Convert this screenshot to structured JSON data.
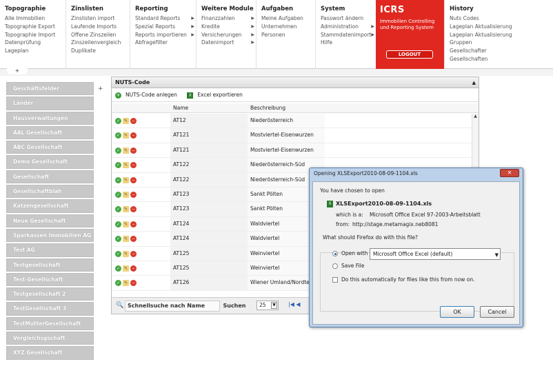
{
  "menu": {
    "topographie": {
      "title": "Topographie",
      "items": [
        "Alle Immobilien",
        "Topographie Export",
        "Topographie Import",
        "Datenprüfung",
        "Lageplan"
      ]
    },
    "zinslisten": {
      "title": "Zinslisten",
      "items": [
        "Zinslisten import",
        "Laufende Imports",
        "Offene Zinszeilen",
        "Zinszeilenvergleich",
        "Duplikate"
      ]
    },
    "reporting": {
      "title": "Reporting",
      "items": [
        "Standard Reports",
        "Spezial Reports",
        "Reports importieren",
        "Abfragefilter"
      ]
    },
    "weitere": {
      "title": "Weitere Module",
      "items": [
        "Finanzzahlen",
        "Kredite",
        "Versicherungen",
        "Datenimport"
      ]
    },
    "aufgaben": {
      "title": "Aufgaben",
      "items": [
        "Meine Aufgaben",
        "Unternehmen",
        "Personen"
      ]
    },
    "system": {
      "title": "System",
      "items": [
        "Passwort ändern",
        "Administration",
        "Stammdatenimport",
        "Hilfe"
      ]
    },
    "history": {
      "title": "History",
      "items": [
        "Nuts Codes",
        "Lageplan Aktualisierung",
        "Lageplan Aktualisierung",
        "Gruppen",
        "Gesellschafter",
        "Gesellschaften"
      ]
    }
  },
  "icrs": {
    "title": "ICRS",
    "subtitle": "Immobilien Controlling und Reporting System",
    "logout": "LOGOUT"
  },
  "plus_tab": "+",
  "sidebar": {
    "plus": "+",
    "items": [
      "Geschäftsfelder",
      "Länder",
      "Hausverwaltungen",
      "AAL Gesellschaft",
      "ABC Gesellschaft",
      "Demo Gesellschaft",
      "Gesellschaft",
      "Gesellschaftblah",
      "Katzengesellschaft",
      "Neue Gesellschaft",
      "Sparkassen Immobilien AG",
      "Test AG",
      "Testgesellschaft",
      "Test-Gesellschaft",
      "Testgesellschaft 2",
      "TestGesellschaft 3",
      "TestMutterGesellschaft",
      "Vergleichsgschaft",
      "XYZ Gesellschaft"
    ]
  },
  "panel": {
    "title": "NUTS-Code",
    "collapse": "▲",
    "add_label": "NUTS-Code anlegen",
    "export_label": "Excel exportieren",
    "columns": {
      "name": "Name",
      "beschreibung": "Beschreibung"
    },
    "rows": [
      {
        "name": "AT12",
        "desc": "Niederösterreich"
      },
      {
        "name": "AT121",
        "desc": "Mostviertel-Eisenwurzen"
      },
      {
        "name": "AT121",
        "desc": "Mostviertel-Eisenwurzen"
      },
      {
        "name": "AT122",
        "desc": "Niederösterreich-Süd"
      },
      {
        "name": "AT122",
        "desc": "Niederösterreich-Süd"
      },
      {
        "name": "AT123",
        "desc": "Sankt Pölten"
      },
      {
        "name": "AT123",
        "desc": "Sankt Pölten"
      },
      {
        "name": "AT124",
        "desc": "Waldviertel"
      },
      {
        "name": "AT124",
        "desc": "Waldviertel"
      },
      {
        "name": "AT125",
        "desc": "Weinviertel"
      },
      {
        "name": "AT125",
        "desc": "Weinviertel"
      },
      {
        "name": "AT126",
        "desc": "Wiener Umland/Nordteil"
      }
    ],
    "search_placeholder": "Schnellsuche nach Name",
    "search_button": "Suchen",
    "page_size": "25"
  },
  "dialog": {
    "title": "Opening XLSExport2010-08-09-1104.xls",
    "close": "✕",
    "chosen": "You have chosen to open",
    "filename": "XLSExport2010-08-09-1104.xls",
    "which_is_label": "which is a:",
    "which_is_value": "Microsoft Office Excel 97-2003-Arbeitsblatt",
    "from_label": "from:",
    "from_value": "http://stage.metamagix.neb8081",
    "question": "What should Firefox do with this file?",
    "open_with": "Open with",
    "open_with_app": "Microsoft Office Excel (default)",
    "save_file": "Save File",
    "auto": "Do this automatically for files like this from now on.",
    "ok": "OK",
    "cancel": "Cancel"
  }
}
